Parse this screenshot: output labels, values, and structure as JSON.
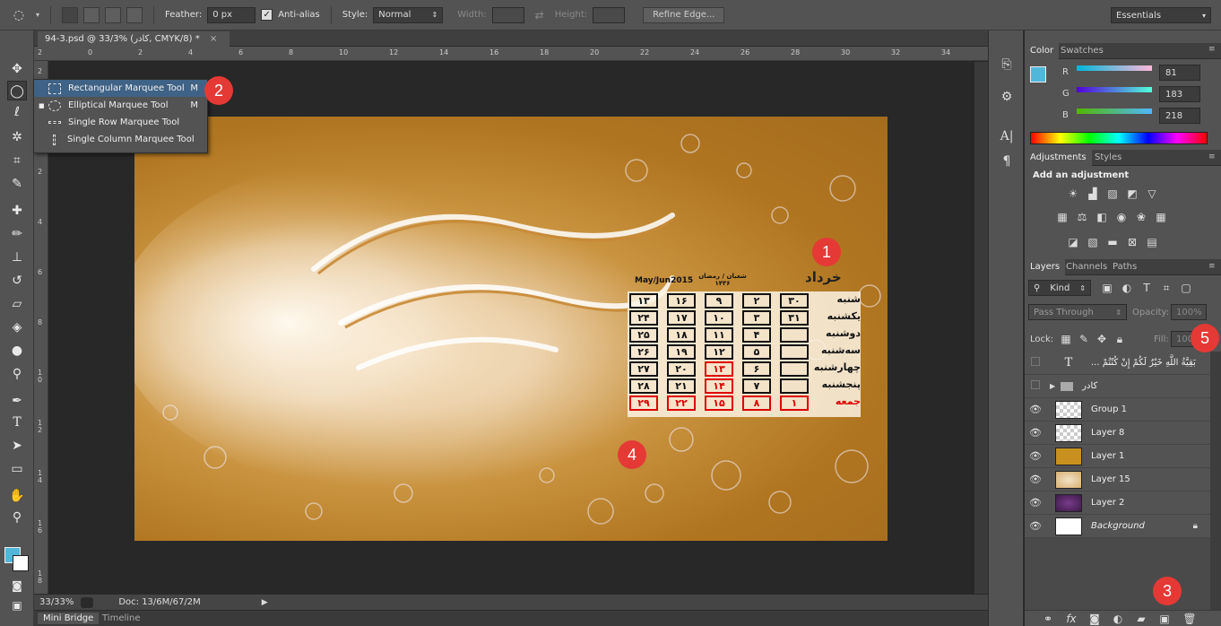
{
  "options_bar": {
    "feather_label": "Feather:",
    "feather_value": "0 px",
    "antialias_label": "Anti-alias",
    "style_label": "Style:",
    "style_value": "Normal",
    "width_label": "Width:",
    "height_label": "Height:",
    "refine_edge": "Refine Edge...",
    "workspace": "Essentials"
  },
  "document": {
    "tab_title": "94-3.psd @ 33/3% (کادر, CMYK/8) *",
    "ruler_h": [
      "2",
      "0",
      "2",
      "4",
      "6",
      "8",
      "10",
      "12",
      "14",
      "16",
      "18",
      "20",
      "22",
      "24",
      "26",
      "28",
      "30",
      "32",
      "34"
    ],
    "ruler_v": [
      "2",
      "0",
      "2",
      "4",
      "6",
      "8",
      "1\n0",
      "1\n2",
      "1\n4",
      "1\n6",
      "1\n8"
    ],
    "zoom": "33/33%",
    "doc_info": "Doc: 13/6M/67/2M"
  },
  "bottom_tabs": [
    "Mini Bridge",
    "Timeline"
  ],
  "flyout": [
    {
      "label": "Rectangular Marquee Tool",
      "key": "M",
      "selected": true
    },
    {
      "label": "Elliptical Marquee Tool",
      "key": "M",
      "selected": false
    },
    {
      "label": "Single Row Marquee Tool",
      "key": "",
      "selected": false
    },
    {
      "label": "Single Column Marquee Tool",
      "key": "",
      "selected": false
    }
  ],
  "artwork": {
    "month_title": "خرداد",
    "date_left": "May/Jun2015",
    "date_right": "شعبان / رمضان ۱۴۳۶",
    "weekdays": [
      "شنبه",
      "یکشنبه",
      "دوشنبه",
      "سه‌شنبه",
      "چهارشنبه",
      "پنجشنبه",
      "جمعه"
    ],
    "col_days": [
      [
        "۱۳",
        "۲۴",
        "۲۵",
        "۲۶",
        "۲۷",
        "۲۸",
        "۲۹"
      ],
      [
        "۱۶",
        "۱۷",
        "۱۸",
        "۱۹",
        "۲۰",
        "۲۱",
        "۲۲"
      ],
      [
        "۹",
        "۱۰",
        "۱۱",
        "۱۲",
        "۱۳",
        "۱۴",
        "۱۵"
      ],
      [
        "۲",
        "۳",
        "۴",
        "۵",
        "۶",
        "۷",
        "۸"
      ],
      [
        "۳۰",
        "۳۱",
        "",
        "",
        "",
        "",
        "۱"
      ]
    ]
  },
  "color_panel": {
    "tabs": [
      "Color",
      "Swatches"
    ],
    "r_label": "R",
    "r_value": "81",
    "g_label": "G",
    "g_value": "183",
    "b_label": "B",
    "b_value": "218",
    "fg_color": "#51b7da"
  },
  "adjustments_panel": {
    "tabs": [
      "Adjustments",
      "Styles"
    ],
    "title": "Add an adjustment"
  },
  "layers_panel": {
    "tabs": [
      "Layers",
      "Channels",
      "Paths"
    ],
    "filter": "Kind",
    "blend_mode": "Pass Through",
    "opacity_label": "Opacity:",
    "opacity_value": "100%",
    "lock_label": "Lock:",
    "fill_label": "Fill:",
    "fill_value": "100%",
    "layers": [
      {
        "name": "... بَقِيَّةُ اللَّهِ خَيْرٌ لَكُمْ إِنْ كُنْتُمْ",
        "type": "text",
        "visible": false
      },
      {
        "name": "کادر",
        "type": "group",
        "visible": false
      },
      {
        "name": "Group 1",
        "type": "layer",
        "visible": true
      },
      {
        "name": "Layer 8",
        "type": "layer",
        "visible": true
      },
      {
        "name": "Layer 1",
        "type": "layer",
        "visible": true
      },
      {
        "name": "Layer 15",
        "type": "layer",
        "visible": true
      },
      {
        "name": "Layer 2",
        "type": "layer",
        "visible": true
      },
      {
        "name": "Background",
        "type": "background",
        "visible": true
      }
    ]
  },
  "badges": [
    "1",
    "2",
    "3",
    "4",
    "5"
  ]
}
